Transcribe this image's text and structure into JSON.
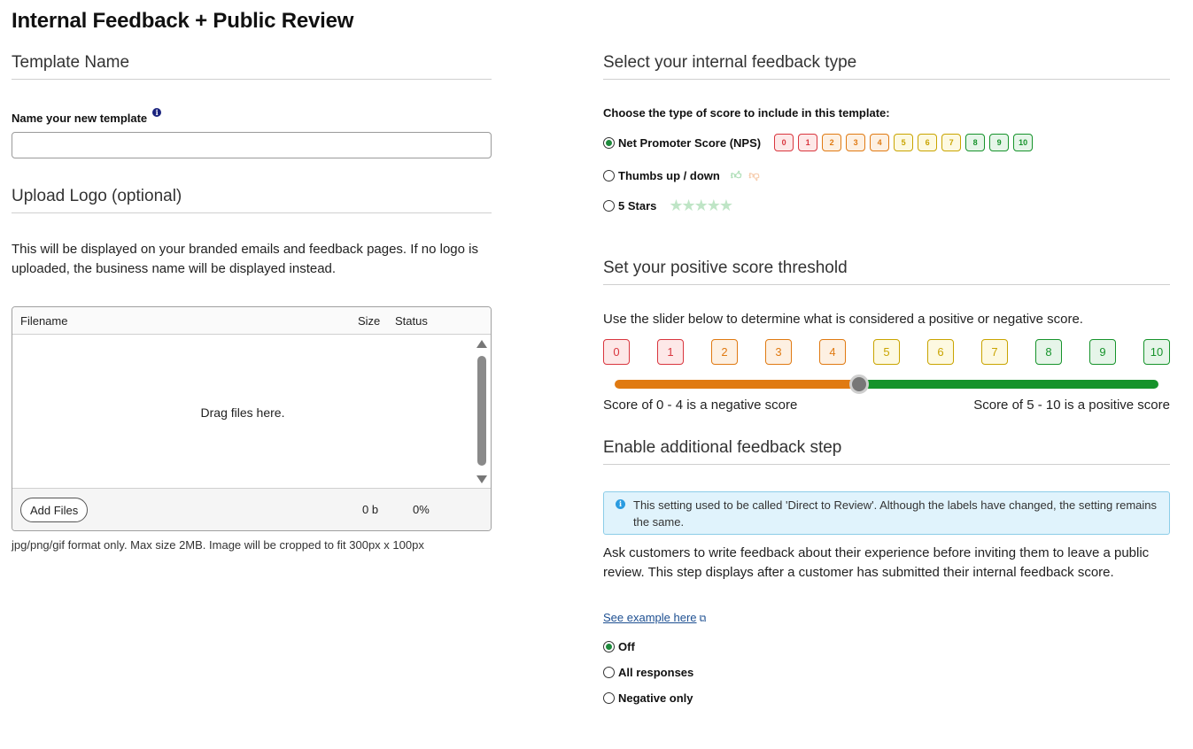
{
  "page": {
    "title": "Internal Feedback + Public Review"
  },
  "template": {
    "heading": "Template Name",
    "label": "Name your new template",
    "info_icon": "info-icon",
    "input_value": "",
    "input_placeholder": ""
  },
  "logo": {
    "heading": "Upload Logo (optional)",
    "description": "This will be displayed on your branded emails and feedback pages. If no logo is uploaded, the business name will be displayed instead.",
    "columns": {
      "filename": "Filename",
      "size": "Size",
      "status": "Status"
    },
    "drop_text": "Drag files here.",
    "add_files_label": "Add Files",
    "total_size": "0 b",
    "total_status": "0%",
    "hint": "jpg/png/gif format only. Max size 2MB. Image will be cropped to fit 300px x 100px"
  },
  "feedback_type": {
    "heading": "Select your internal feedback type",
    "choose_label": "Choose the type of score to include in this template:",
    "options": [
      {
        "label": "Net Promoter Score (NPS)",
        "selected": true
      },
      {
        "label": "Thumbs up / down",
        "selected": false
      },
      {
        "label": "5 Stars",
        "selected": false
      }
    ],
    "nps_scale": [
      "0",
      "1",
      "2",
      "3",
      "4",
      "5",
      "6",
      "7",
      "8",
      "9",
      "10"
    ],
    "thumb_icons": [
      "thumbs-up-icon",
      "thumbs-down-icon"
    ],
    "stars": "★★★★★"
  },
  "threshold": {
    "heading": "Set your positive score threshold",
    "description": "Use the slider below to determine what is considered a positive or negative score.",
    "scale": [
      "0",
      "1",
      "2",
      "3",
      "4",
      "5",
      "6",
      "7",
      "8",
      "9",
      "10"
    ],
    "threshold_value": 4.5,
    "scale_min": 0,
    "scale_max": 10,
    "negative_label": "Score of 0 - 4 is a negative score",
    "positive_label": "Score of 5 - 10 is a positive score"
  },
  "additional": {
    "heading": "Enable additional feedback step",
    "banner": "This setting used to be called 'Direct to Review'. Although the labels have changed, the setting remains the same.",
    "description": "Ask customers to write feedback about their experience before inviting them to leave a public review. This step displays after a customer has submitted their internal feedback score.",
    "example_link": "See example here",
    "options": [
      {
        "label": "Off",
        "selected": true
      },
      {
        "label": "All responses",
        "selected": false
      },
      {
        "label": "Negative only",
        "selected": false
      }
    ]
  },
  "colors": {
    "red": "#d9363e",
    "orange": "#e07a12",
    "yellow": "#c9a400",
    "green": "#16932b",
    "radio_checked": "#1e8a3c",
    "link": "#1d4f91",
    "banner_bg": "#e0f3fc"
  }
}
